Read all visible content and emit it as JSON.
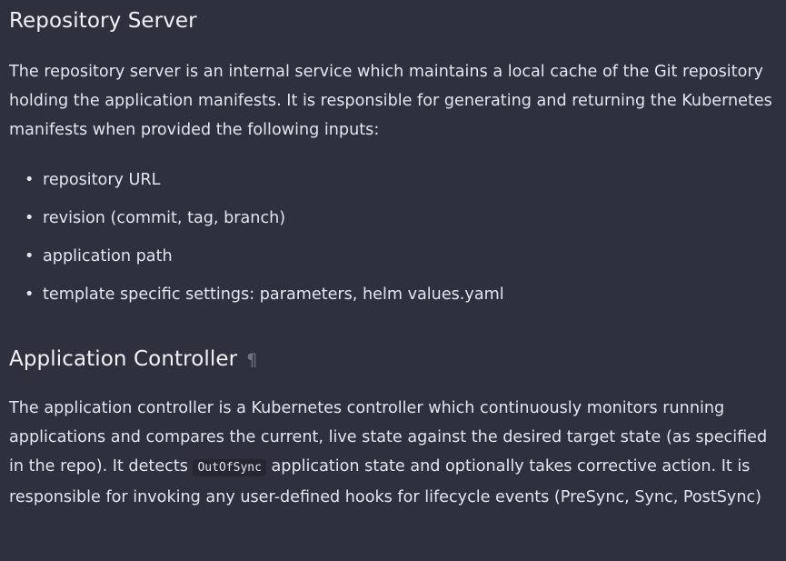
{
  "sections": [
    {
      "heading": "Repository Server",
      "paragraph": "The repository server is an internal service which maintains a local cache of the Git repository holding the application manifests. It is responsible for generating and returning the Kubernetes manifests when provided the following inputs:",
      "list": [
        "repository URL",
        "revision (commit, tag, branch)",
        "application path",
        "template specific settings: parameters, helm values.yaml"
      ]
    },
    {
      "heading": "Application Controller",
      "headerlink": "¶",
      "paragraph_before_code": "The application controller is a Kubernetes controller which continuously monitors running applications and compares the current, live state against the desired target state (as specified in the repo). It detects ",
      "code": "OutOfSync",
      "paragraph_after_code": " application state and optionally takes corrective action. It is responsible for invoking any user-defined hooks for lifecycle events (PreSync, Sync, PostSync)"
    }
  ],
  "bullet_glyph": "•"
}
